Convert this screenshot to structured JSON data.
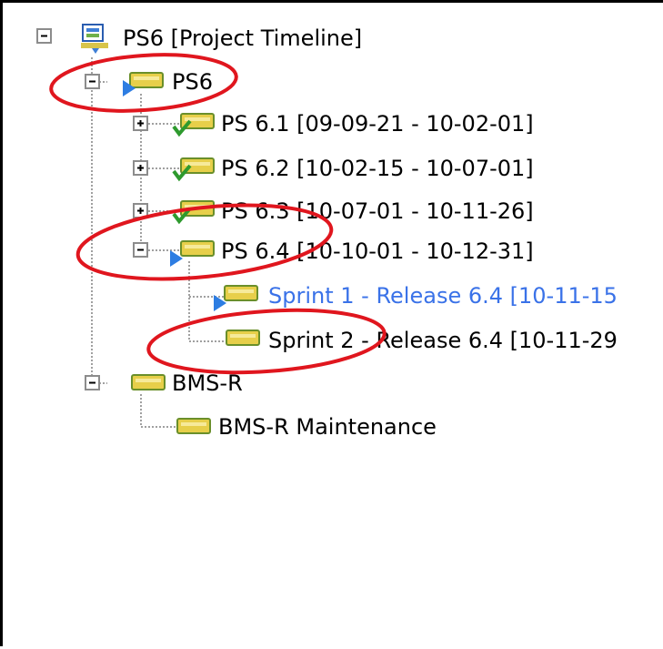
{
  "tree": {
    "root": {
      "label": "PS6 [Project Timeline]",
      "icon": "project-timeline-icon"
    },
    "ps6": {
      "label": "PS6",
      "icon": "active-iteration-icon"
    },
    "ps61": {
      "label": "PS 6.1 [09-09-21 - 10-02-01]",
      "icon": "completed-iteration-icon"
    },
    "ps62": {
      "label": "PS 6.2 [10-02-15 - 10-07-01]",
      "icon": "completed-iteration-icon"
    },
    "ps63": {
      "label": "PS 6.3 [10-07-01 - 10-11-26]",
      "icon": "completed-iteration-icon"
    },
    "ps64": {
      "label": "PS 6.4 [10-10-01 - 10-12-31]",
      "icon": "active-iteration-icon"
    },
    "sprint1": {
      "label": "Sprint 1 - Release 6.4 [10-11-15",
      "icon": "active-iteration-icon"
    },
    "sprint2": {
      "label": "Sprint 2 - Release 6.4 [10-11-29",
      "icon": "iteration-icon"
    },
    "bmsr": {
      "label": "BMS-R",
      "icon": "iteration-icon"
    },
    "bmsrMaint": {
      "label": "BMS-R Maintenance",
      "icon": "iteration-icon"
    }
  },
  "colors": {
    "active_text": "#3a72e8",
    "annotation": "#e0161e",
    "iteration_fill": "#e7cf4a",
    "check": "#2e9a2e",
    "play": "#2d7de2"
  }
}
